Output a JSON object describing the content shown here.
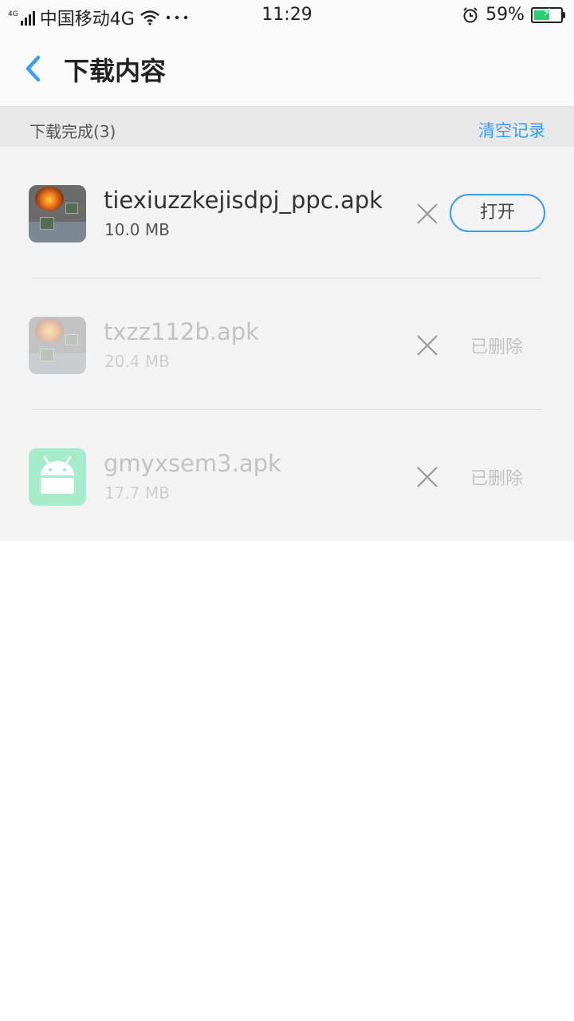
{
  "status_bar": {
    "network_type": "4G",
    "carrier": "中国移动4G",
    "time": "11:29",
    "battery_percent": "59%",
    "battery_level": 0.59,
    "icons": [
      "signal-icon",
      "wifi-icon",
      "more-dots-icon",
      "alarm-icon",
      "battery-icon"
    ]
  },
  "nav": {
    "title": "下载内容",
    "back_icon": "chevron-left-icon"
  },
  "section": {
    "title": "下载完成(3)",
    "clear_label": "清空记录"
  },
  "downloads": [
    {
      "name": "tiexiuzzkejisdpj_ppc.apk",
      "size": "10.0 MB",
      "action": "打开",
      "state": "available",
      "icon": "tank-game-icon"
    },
    {
      "name": "txzz112b.apk",
      "size": "20.4 MB",
      "action": "已删除",
      "state": "deleted",
      "icon": "tank-game-icon"
    },
    {
      "name": "gmyxsem3.apk",
      "size": "17.7 MB",
      "action": "已删除",
      "state": "deleted",
      "icon": "android-icon"
    }
  ],
  "colors": {
    "accent": "#3a9df0",
    "background": "#f3f3f3",
    "header_bg": "#e8e8e8",
    "android_icon_bg": "#a7ecca"
  }
}
